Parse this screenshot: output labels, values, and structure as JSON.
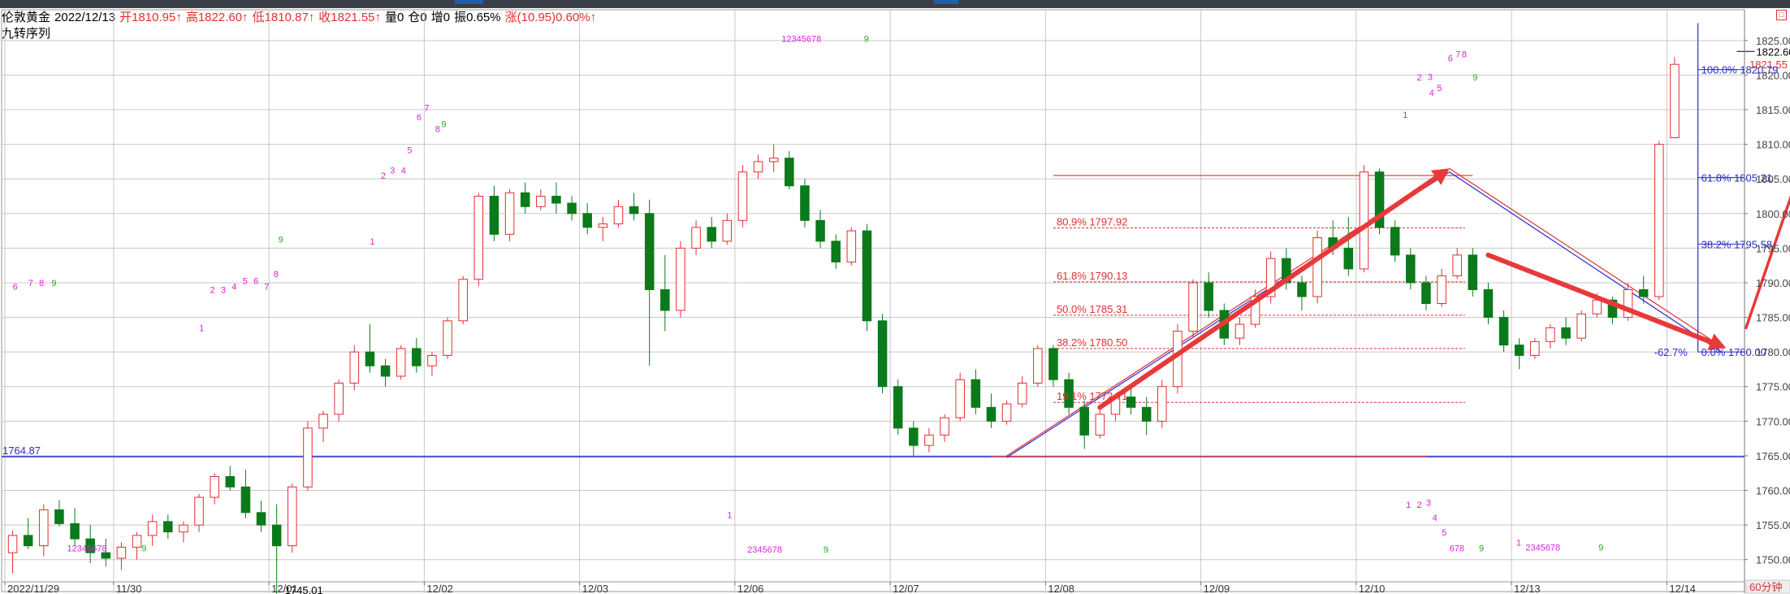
{
  "header": {
    "instrument": "伦敦黄金",
    "date": "2022/12/13",
    "open": "开1810.95↑",
    "high": "高1822.60↑",
    "low": "低1810.87↑",
    "close": "收1821.55↑",
    "volume": "量0",
    "position": "仓0",
    "increase": "增0",
    "amplitude": "振0.65%",
    "change": "涨(10.95)0.60%↑",
    "study": "九转序列"
  },
  "colors": {
    "up": "#e03030",
    "down": "#0a7a1a",
    "grid": "#c8c8c8",
    "fib_blue": "#2222cc",
    "nine_magenta": "#dd22dd",
    "nine_green": "#22aa22",
    "last_price_red": "#e03030"
  },
  "chart_data": {
    "type": "candlestick",
    "title": "伦敦黄金",
    "ylim": [
      1747.5,
      1828.5
    ],
    "y_ticks": [
      1750,
      1755,
      1760,
      1765,
      1770,
      1775,
      1780,
      1785,
      1790,
      1795,
      1800,
      1805,
      1810,
      1815,
      1820,
      1825
    ],
    "y_tick_labels": [
      "1750.00",
      "1755.00",
      "1760.00",
      "1765.00",
      "1770.00",
      "1775.00",
      "1780.00",
      "1785.00",
      "1790.00",
      "1795.00",
      "1800.00",
      "1805.00",
      "1810.00",
      "1815.00",
      "1820.00",
      "1825.00"
    ],
    "x_labels": [
      "2022/11/29",
      "11/30",
      "12/01",
      "12/02",
      "12/03",
      "12/06",
      "12/07",
      "12/08",
      "12/09",
      "12/10",
      "12/13",
      "12/14"
    ],
    "x_label_bars": [
      0,
      7,
      17,
      27,
      37,
      47,
      57,
      67,
      77,
      87,
      97,
      107
    ],
    "timeframe": "60分钟",
    "num_bars": 112,
    "candles": [
      [
        1751.0,
        1754.2,
        1748.0,
        1753.5
      ],
      [
        1753.5,
        1756.0,
        1751.5,
        1752.0
      ],
      [
        1752.0,
        1758.0,
        1750.5,
        1757.2
      ],
      [
        1757.2,
        1758.6,
        1754.8,
        1755.2
      ],
      [
        1755.2,
        1757.5,
        1752.0,
        1753.0
      ],
      [
        1753.0,
        1755.0,
        1749.5,
        1751.0
      ],
      [
        1751.0,
        1753.0,
        1749.0,
        1750.2
      ],
      [
        1750.2,
        1752.5,
        1748.5,
        1751.8
      ],
      [
        1751.8,
        1754.0,
        1750.0,
        1753.5
      ],
      [
        1753.5,
        1756.5,
        1752.0,
        1755.5
      ],
      [
        1755.5,
        1756.5,
        1753.0,
        1754.0
      ],
      [
        1754.0,
        1755.5,
        1752.5,
        1755.0
      ],
      [
        1755.0,
        1759.5,
        1754.0,
        1759.0
      ],
      [
        1759.0,
        1762.5,
        1758.0,
        1762.0
      ],
      [
        1762.0,
        1763.5,
        1760.0,
        1760.5
      ],
      [
        1760.5,
        1763.0,
        1756.0,
        1756.8
      ],
      [
        1756.8,
        1758.5,
        1754.0,
        1755.0
      ],
      [
        1755.0,
        1758.0,
        1745.0,
        1752.0
      ],
      [
        1752.0,
        1761.0,
        1751.0,
        1760.5
      ],
      [
        1760.5,
        1770.0,
        1760.0,
        1769.0
      ],
      [
        1769.0,
        1771.5,
        1767.0,
        1771.0
      ],
      [
        1771.0,
        1776.0,
        1770.0,
        1775.5
      ],
      [
        1775.5,
        1781.0,
        1774.5,
        1780.0
      ],
      [
        1780.0,
        1784.0,
        1777.0,
        1778.0
      ],
      [
        1778.0,
        1779.0,
        1775.0,
        1776.5
      ],
      [
        1776.5,
        1781.0,
        1776.0,
        1780.5
      ],
      [
        1780.5,
        1782.0,
        1777.0,
        1778.0
      ],
      [
        1778.0,
        1780.0,
        1776.5,
        1779.5
      ],
      [
        1779.5,
        1785.0,
        1779.0,
        1784.5
      ],
      [
        1784.5,
        1791.0,
        1784.0,
        1790.5
      ],
      [
        1790.5,
        1803.0,
        1789.5,
        1802.5
      ],
      [
        1802.5,
        1804.0,
        1796.0,
        1797.0
      ],
      [
        1797.0,
        1803.5,
        1796.0,
        1803.0
      ],
      [
        1803.0,
        1804.5,
        1800.0,
        1801.0
      ],
      [
        1801.0,
        1803.5,
        1800.5,
        1802.5
      ],
      [
        1802.5,
        1804.5,
        1800.0,
        1801.5
      ],
      [
        1801.5,
        1802.5,
        1799.0,
        1800.0
      ],
      [
        1800.0,
        1801.5,
        1797.0,
        1798.0
      ],
      [
        1798.0,
        1799.5,
        1796.0,
        1798.5
      ],
      [
        1798.5,
        1802.0,
        1798.0,
        1801.0
      ],
      [
        1801.0,
        1803.0,
        1799.0,
        1800.0
      ],
      [
        1800.0,
        1802.0,
        1778.0,
        1789.0
      ],
      [
        1789.0,
        1794.0,
        1783.0,
        1786.0
      ],
      [
        1786.0,
        1796.0,
        1785.0,
        1795.0
      ],
      [
        1795.0,
        1799.0,
        1794.0,
        1798.0
      ],
      [
        1798.0,
        1799.5,
        1795.0,
        1796.0
      ],
      [
        1796.0,
        1800.0,
        1795.5,
        1799.0
      ],
      [
        1799.0,
        1807.0,
        1798.0,
        1806.0
      ],
      [
        1806.0,
        1808.5,
        1805.0,
        1807.5
      ],
      [
        1807.5,
        1810.0,
        1806.0,
        1808.0
      ],
      [
        1808.0,
        1809.0,
        1803.5,
        1804.0
      ],
      [
        1804.0,
        1805.0,
        1798.0,
        1799.0
      ],
      [
        1799.0,
        1800.5,
        1795.0,
        1796.0
      ],
      [
        1796.0,
        1797.0,
        1792.0,
        1793.0
      ],
      [
        1793.0,
        1798.0,
        1792.5,
        1797.5
      ],
      [
        1797.5,
        1798.5,
        1783.0,
        1784.5
      ],
      [
        1784.5,
        1785.5,
        1774.0,
        1775.0
      ],
      [
        1775.0,
        1776.0,
        1768.0,
        1769.0
      ],
      [
        1769.0,
        1770.0,
        1765.0,
        1766.5
      ],
      [
        1766.5,
        1769.0,
        1765.5,
        1768.0
      ],
      [
        1768.0,
        1771.0,
        1767.0,
        1770.5
      ],
      [
        1770.5,
        1777.0,
        1770.0,
        1776.0
      ],
      [
        1776.0,
        1777.5,
        1771.0,
        1772.0
      ],
      [
        1772.0,
        1774.0,
        1769.0,
        1770.0
      ],
      [
        1770.0,
        1773.0,
        1769.5,
        1772.5
      ],
      [
        1772.5,
        1776.5,
        1772.0,
        1775.5
      ],
      [
        1775.5,
        1781.0,
        1775.0,
        1780.5
      ],
      [
        1780.5,
        1781.0,
        1775.0,
        1776.0
      ],
      [
        1776.0,
        1777.0,
        1771.0,
        1772.0
      ],
      [
        1772.0,
        1773.0,
        1766.0,
        1768.0
      ],
      [
        1768.0,
        1772.0,
        1767.5,
        1771.0
      ],
      [
        1771.0,
        1774.0,
        1770.0,
        1773.5
      ],
      [
        1773.5,
        1775.0,
        1771.0,
        1772.0
      ],
      [
        1772.0,
        1773.5,
        1768.0,
        1770.0
      ],
      [
        1770.0,
        1776.0,
        1769.0,
        1775.0
      ],
      [
        1775.0,
        1784.0,
        1774.0,
        1783.0
      ],
      [
        1783.0,
        1790.5,
        1782.0,
        1790.0
      ],
      [
        1790.0,
        1791.5,
        1785.0,
        1786.0
      ],
      [
        1786.0,
        1787.0,
        1781.0,
        1782.0
      ],
      [
        1782.0,
        1785.0,
        1781.0,
        1784.0
      ],
      [
        1784.0,
        1789.0,
        1783.5,
        1788.0
      ],
      [
        1788.0,
        1794.5,
        1787.0,
        1793.5
      ],
      [
        1793.5,
        1795.0,
        1789.0,
        1790.0
      ],
      [
        1790.0,
        1791.0,
        1786.0,
        1788.0
      ],
      [
        1788.0,
        1797.5,
        1787.0,
        1796.5
      ],
      [
        1796.5,
        1799.0,
        1794.0,
        1795.0
      ],
      [
        1795.0,
        1799.5,
        1791.0,
        1792.0
      ],
      [
        1792.0,
        1807.0,
        1791.5,
        1806.0
      ],
      [
        1806.0,
        1806.5,
        1797.0,
        1798.0
      ],
      [
        1798.0,
        1799.0,
        1793.0,
        1794.0
      ],
      [
        1794.0,
        1795.0,
        1789.0,
        1790.0
      ],
      [
        1790.0,
        1791.0,
        1786.0,
        1787.0
      ],
      [
        1787.0,
        1792.0,
        1786.5,
        1791.0
      ],
      [
        1791.0,
        1795.0,
        1790.5,
        1794.0
      ],
      [
        1794.0,
        1795.0,
        1788.0,
        1789.0
      ],
      [
        1789.0,
        1790.0,
        1784.0,
        1785.0
      ],
      [
        1785.0,
        1786.0,
        1780.0,
        1781.0
      ],
      [
        1781.0,
        1782.0,
        1777.5,
        1779.5
      ],
      [
        1779.5,
        1782.0,
        1779.0,
        1781.5
      ],
      [
        1781.5,
        1784.0,
        1780.5,
        1783.5
      ],
      [
        1783.5,
        1785.0,
        1781.0,
        1782.0
      ],
      [
        1782.0,
        1786.0,
        1781.5,
        1785.5
      ],
      [
        1785.5,
        1788.5,
        1785.0,
        1787.5
      ],
      [
        1787.5,
        1788.0,
        1784.0,
        1785.0
      ],
      [
        1785.0,
        1790.0,
        1784.5,
        1789.0
      ],
      [
        1789.0,
        1791.0,
        1787.0,
        1788.0
      ],
      [
        1788.0,
        1810.5,
        1787.5,
        1810.0
      ],
      [
        1810.95,
        1822.6,
        1810.87,
        1821.55
      ]
    ],
    "last_price": "1821.55",
    "high_marker": "1822.60",
    "low_marker": "1745.01",
    "support_line_value": 1764.87,
    "support_line_label": "1764.87",
    "fib_left": [
      {
        "label": "80.9% 1797.92",
        "value": 1797.92
      },
      {
        "label": "61.8% 1790.13",
        "value": 1790.13
      },
      {
        "label": "50.0% 1785.31",
        "value": 1785.31
      },
      {
        "label": "38.2% 1780.50",
        "value": 1780.5
      },
      {
        "label": "19.1% 1772.71",
        "value": 1772.71
      }
    ],
    "fib_right": [
      {
        "label": "100.0% 1820.79",
        "value": 1820.79
      },
      {
        "label": "61.8% 1805.21",
        "value": 1805.21
      },
      {
        "label": "38.2% 1795.58",
        "value": 1795.58
      },
      {
        "label": "0.0% 1780.00",
        "value": 1780.0
      }
    ],
    "fib_right_extra": "-62.7%",
    "fib_left_top": 1805.5,
    "fib_left_bottom": 1764.87,
    "nine_sequences": [
      {
        "text": "6",
        "bar": 0,
        "price": 1789.0,
        "color": "m"
      },
      {
        "text": "7",
        "bar": 1,
        "price": 1789.5,
        "color": "m"
      },
      {
        "text": "8",
        "bar": 1.7,
        "price": 1789.5,
        "color": "m"
      },
      {
        "text": "9",
        "bar": 2.5,
        "price": 1789.5,
        "color": "g"
      },
      {
        "text": "1",
        "bar": 12,
        "price": 1783.0,
        "color": "m"
      },
      {
        "text": "2",
        "bar": 12.7,
        "price": 1788.5,
        "color": "m"
      },
      {
        "text": "3",
        "bar": 13.4,
        "price": 1788.5,
        "color": "m"
      },
      {
        "text": "4",
        "bar": 14.1,
        "price": 1789.0,
        "color": "m"
      },
      {
        "text": "5",
        "bar": 14.8,
        "price": 1789.8,
        "color": "m"
      },
      {
        "text": "6",
        "bar": 15.5,
        "price": 1789.8,
        "color": "m"
      },
      {
        "text": "7",
        "bar": 16.2,
        "price": 1789.0,
        "color": "m"
      },
      {
        "text": "8",
        "bar": 16.8,
        "price": 1790.8,
        "color": "m"
      },
      {
        "text": "9",
        "bar": 17.1,
        "price": 1795.8,
        "color": "g"
      },
      {
        "text": "1",
        "bar": 23,
        "price": 1795.5,
        "color": "m"
      },
      {
        "text": "2",
        "bar": 23.7,
        "price": 1805.0,
        "color": "m"
      },
      {
        "text": "3",
        "bar": 24.3,
        "price": 1805.8,
        "color": "m"
      },
      {
        "text": "4",
        "bar": 25.0,
        "price": 1805.8,
        "color": "m"
      },
      {
        "text": "5",
        "bar": 25.4,
        "price": 1808.7,
        "color": "m"
      },
      {
        "text": "6",
        "bar": 26.0,
        "price": 1813.5,
        "color": "m"
      },
      {
        "text": "7",
        "bar": 26.5,
        "price": 1814.8,
        "color": "m"
      },
      {
        "text": "8",
        "bar": 27.2,
        "price": 1811.8,
        "color": "m"
      },
      {
        "text": "9",
        "bar": 27.6,
        "price": 1812.5,
        "color": "g"
      },
      {
        "text": "12345678",
        "bar": 49.5,
        "price": 1824.8,
        "color": "m"
      },
      {
        "text": "9",
        "bar": 54.8,
        "price": 1824.8,
        "color": "g"
      },
      {
        "text": "1",
        "bar": 89.5,
        "price": 1813.8,
        "color": "m"
      },
      {
        "text": "2",
        "bar": 90.4,
        "price": 1819.2,
        "color": "m"
      },
      {
        "text": "3",
        "bar": 91.1,
        "price": 1819.3,
        "color": "m"
      },
      {
        "text": "4",
        "bar": 91.2,
        "price": 1817.0,
        "color": "m"
      },
      {
        "text": "5",
        "bar": 91.7,
        "price": 1817.7,
        "color": "m"
      },
      {
        "text": "6",
        "bar": 92.4,
        "price": 1822.0,
        "color": "m"
      },
      {
        "text": "7",
        "bar": 92.9,
        "price": 1822.6,
        "color": "m"
      },
      {
        "text": "8",
        "bar": 93.3,
        "price": 1822.6,
        "color": "m"
      },
      {
        "text": "9",
        "bar": 94.0,
        "price": 1819.2,
        "color": "g"
      },
      {
        "text": "12345678",
        "bar": 3.5,
        "price": 1751.2,
        "color": "m"
      },
      {
        "text": "9",
        "bar": 8.3,
        "price": 1751.2,
        "color": "g"
      },
      {
        "text": "1",
        "bar": 46,
        "price": 1756.0,
        "color": "m"
      },
      {
        "text": "2345678",
        "bar": 47.3,
        "price": 1751.0,
        "color": "m"
      },
      {
        "text": "9",
        "bar": 52.2,
        "price": 1751.0,
        "color": "g"
      },
      {
        "text": "1",
        "bar": 89.7,
        "price": 1757.5,
        "color": "m"
      },
      {
        "text": "2",
        "bar": 90.4,
        "price": 1757.5,
        "color": "m"
      },
      {
        "text": "3",
        "bar": 91.0,
        "price": 1757.8,
        "color": "m"
      },
      {
        "text": "4",
        "bar": 91.4,
        "price": 1755.6,
        "color": "m"
      },
      {
        "text": "5",
        "bar": 92.0,
        "price": 1753.5,
        "color": "m"
      },
      {
        "text": "678",
        "bar": 92.5,
        "price": 1751.2,
        "color": "m"
      },
      {
        "text": "9",
        "bar": 94.4,
        "price": 1751.2,
        "color": "g"
      },
      {
        "text": "1",
        "bar": 96.8,
        "price": 1752.0,
        "color": "m"
      },
      {
        "text": "2345678",
        "bar": 97.4,
        "price": 1751.3,
        "color": "m"
      },
      {
        "text": "9",
        "bar": 102.1,
        "price": 1751.3,
        "color": "g"
      }
    ]
  }
}
